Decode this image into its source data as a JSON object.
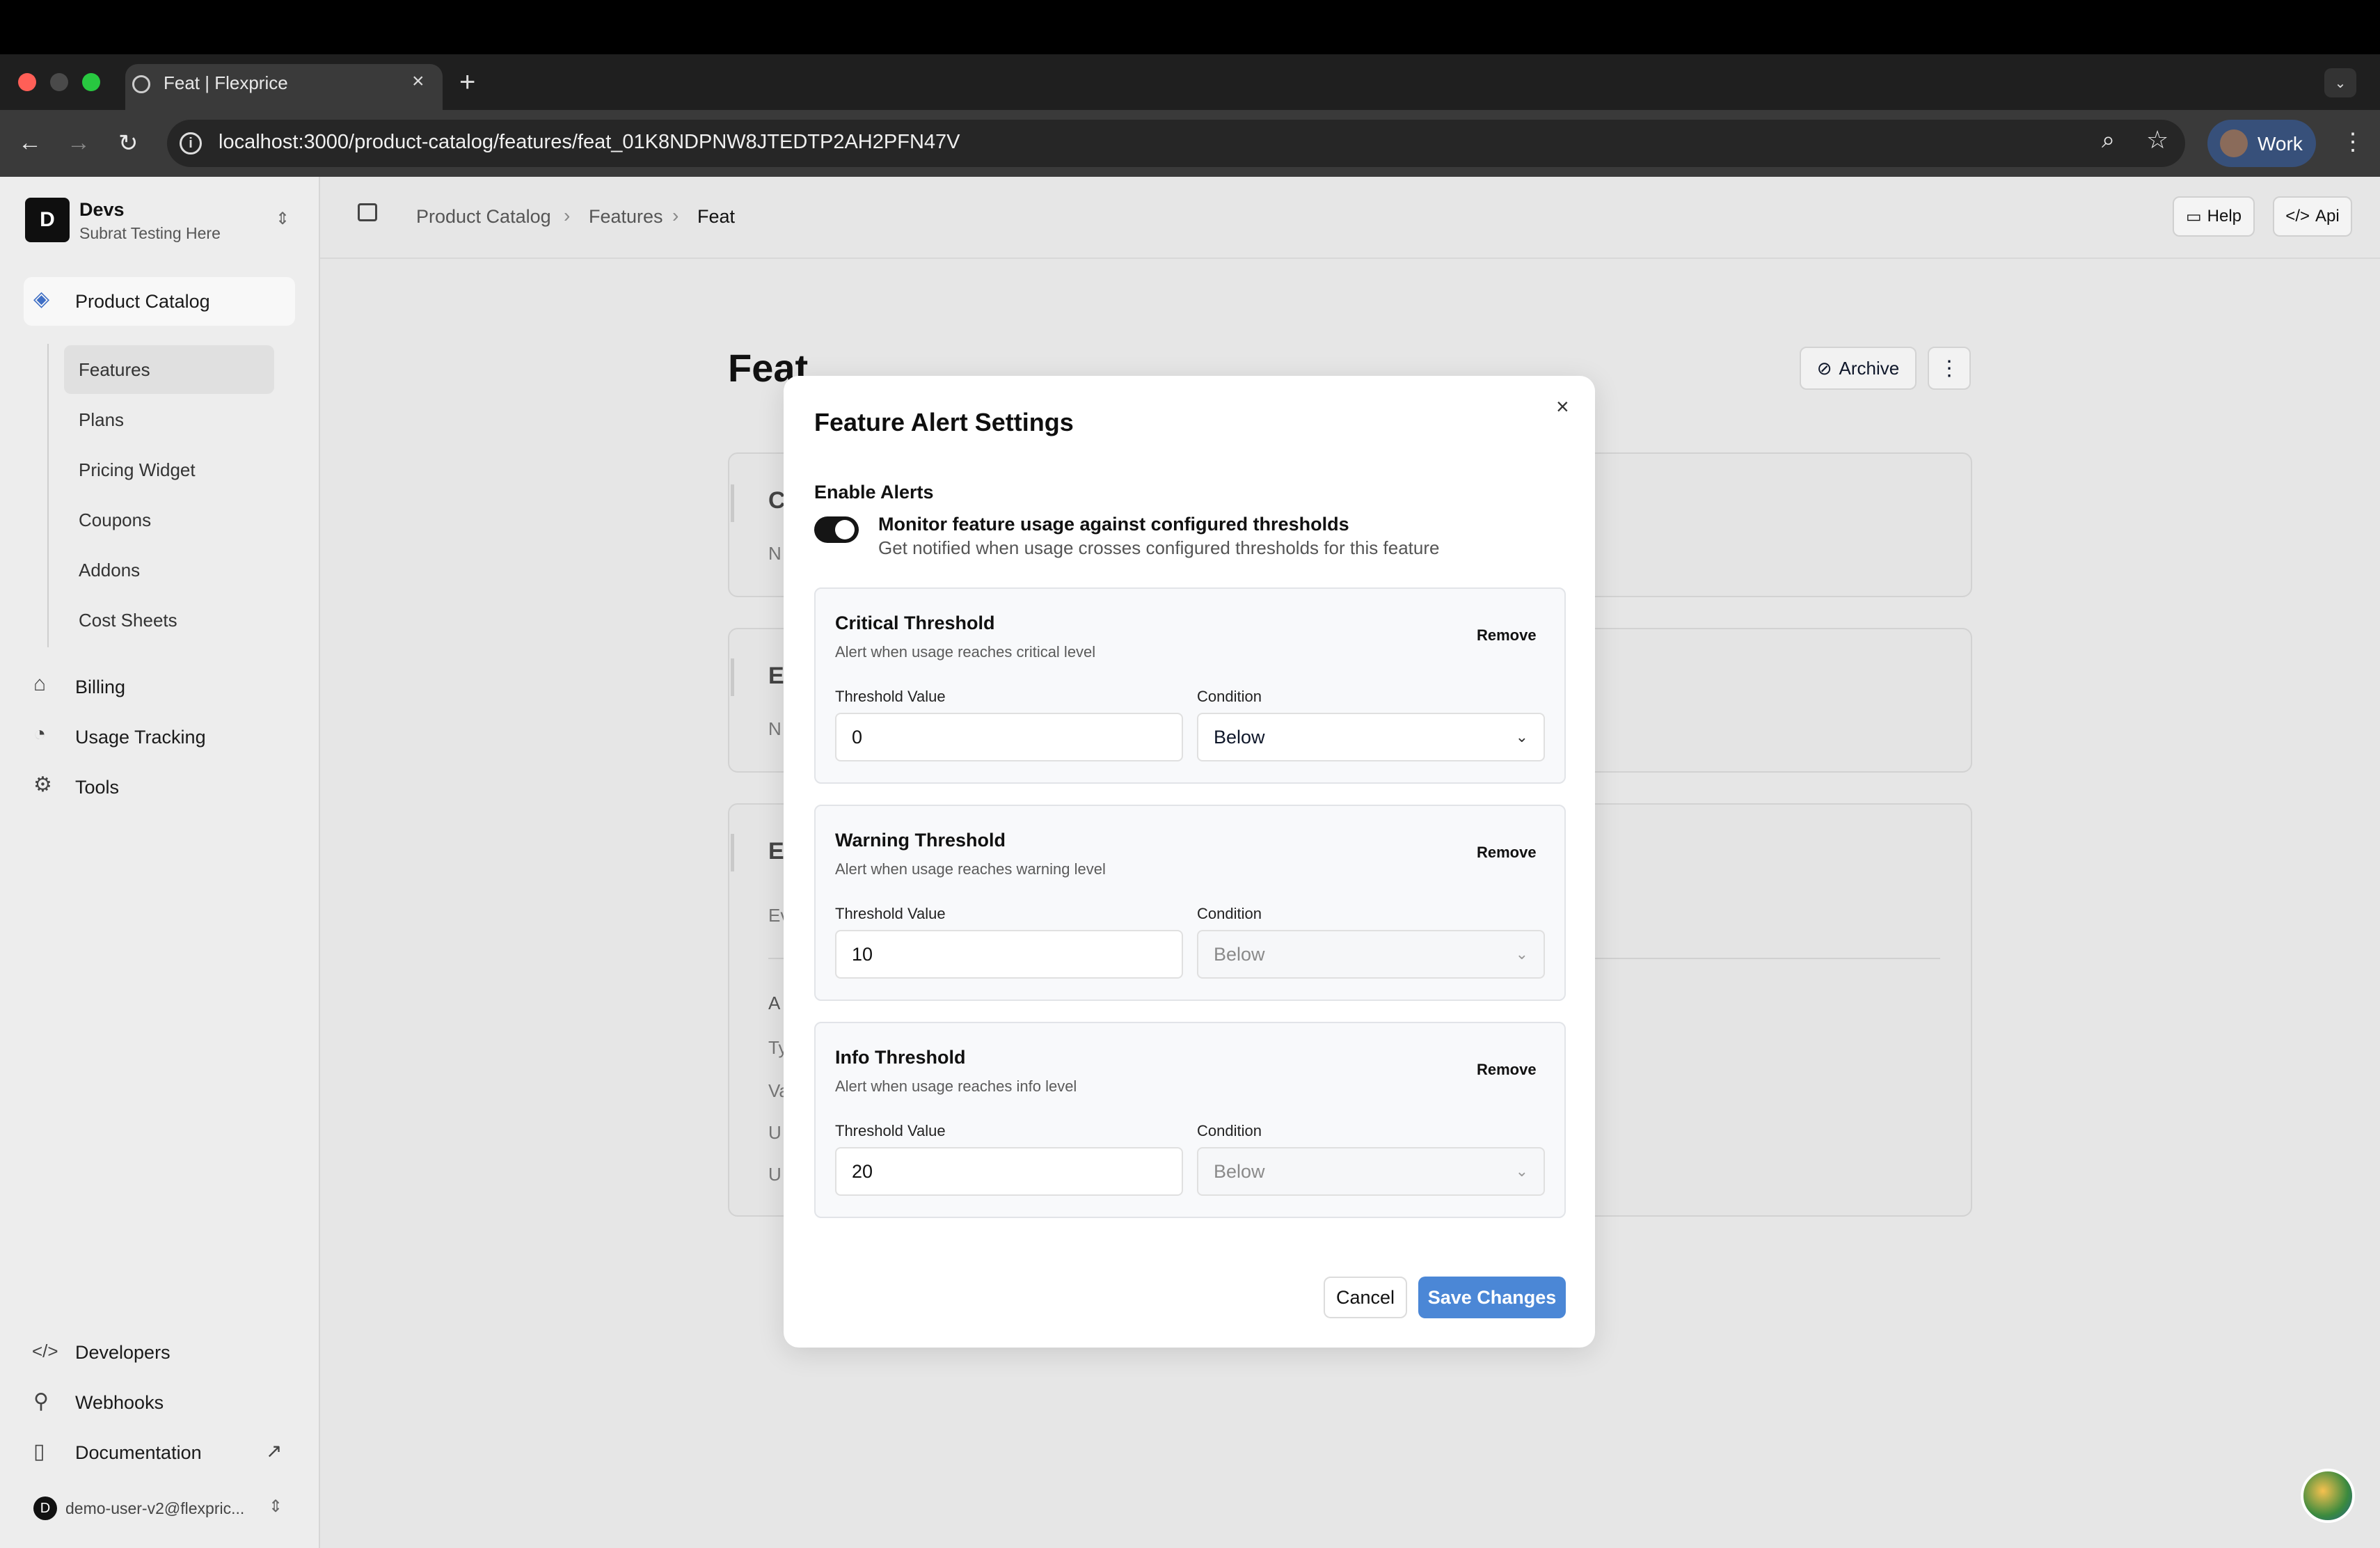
{
  "browser": {
    "tab_title": "Feat | Flexprice",
    "url": "localhost:3000/product-catalog/features/feat_01K8NDPNW8JTEDTP2AH2PFN47V",
    "profile_label": "Work",
    "colors": {
      "chrome_dark": "#1f1f1f",
      "profile_bg": "#37507a"
    }
  },
  "workspace": {
    "initial": "D",
    "name": "Devs",
    "subtitle": "Subrat Testing Here"
  },
  "sidebar": {
    "main_item": "Product Catalog",
    "sub_items": [
      "Features",
      "Plans",
      "Pricing Widget",
      "Coupons",
      "Addons",
      "Cost Sheets"
    ],
    "items": [
      "Billing",
      "Usage Tracking",
      "Tools"
    ],
    "footer_items": [
      "Developers",
      "Webhooks",
      "Documentation"
    ],
    "user_initial": "D",
    "user_email": "demo-user-v2@flexpric..."
  },
  "header": {
    "breadcrumb": [
      "Product Catalog",
      "Features",
      "Feat"
    ],
    "help_label": "Help",
    "api_label": "Api"
  },
  "page": {
    "title": "Feat",
    "archive_label": "Archive",
    "card_letters": [
      "C",
      "E",
      "E"
    ],
    "card_sub_letters": [
      "N",
      "N",
      "Ev"
    ],
    "card3_rows": [
      "A",
      "Ty",
      "Va",
      "U",
      "U"
    ]
  },
  "modal": {
    "title": "Feature Alert Settings",
    "enable_label": "Enable Alerts",
    "toggle_title": "Monitor feature usage against configured thresholds",
    "toggle_desc": "Get notified when usage crosses configured thresholds for this feature",
    "toggle_on": true,
    "value_label": "Threshold Value",
    "condition_label": "Condition",
    "remove_label": "Remove",
    "thresholds": [
      {
        "title": "Critical Threshold",
        "desc": "Alert when usage reaches critical level",
        "value": "0",
        "condition": "Below"
      },
      {
        "title": "Warning Threshold",
        "desc": "Alert when usage reaches warning level",
        "value": "10",
        "condition": "Below"
      },
      {
        "title": "Info Threshold",
        "desc": "Alert when usage reaches info level",
        "value": "20",
        "condition": "Below"
      }
    ],
    "cancel_label": "Cancel",
    "save_label": "Save Changes",
    "colors": {
      "save": "#4b87d6",
      "toggle": "#151515"
    }
  }
}
